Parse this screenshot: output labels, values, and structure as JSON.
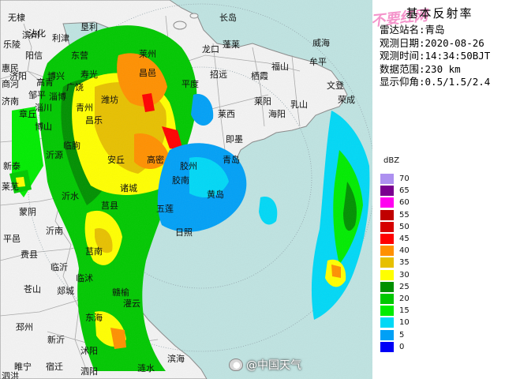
{
  "panel": {
    "title": "基本反射率",
    "stamp": "不要红网",
    "station_label": "雷达站名:青岛",
    "date_label": "观测日期:2020-08-26",
    "time_label": "观测时间:14:34:50BJT",
    "range_label": "数据范围:230 km",
    "elevation_label": "显示仰角:0.5/1.5/2.4"
  },
  "legend": {
    "unit": "dBZ",
    "levels": [
      {
        "label": "70",
        "color": "#ad90f0"
      },
      {
        "label": "65",
        "color": "#7a0090"
      },
      {
        "label": "60",
        "color": "#ff00f0"
      },
      {
        "label": "55",
        "color": "#c00000"
      },
      {
        "label": "50",
        "color": "#d60000"
      },
      {
        "label": "45",
        "color": "#ff0000"
      },
      {
        "label": "40",
        "color": "#ff9000"
      },
      {
        "label": "35",
        "color": "#e7c000"
      },
      {
        "label": "30",
        "color": "#ffff00"
      },
      {
        "label": "25",
        "color": "#009000"
      },
      {
        "label": "20",
        "color": "#00c800"
      },
      {
        "label": "15",
        "color": "#00ec00"
      },
      {
        "label": "10",
        "color": "#00d8f6"
      },
      {
        "label": "5",
        "color": "#01a0f6"
      },
      {
        "label": "0",
        "color": "#0000f6"
      }
    ]
  },
  "cities": [
    "无棣",
    "沾化",
    "利津",
    "寿光",
    "长岛",
    "蓬莱",
    "龙口",
    "招远",
    "栖霞",
    "福山",
    "牟平",
    "威海",
    "文登",
    "荣成",
    "乳山",
    "海阳",
    "莱阳",
    "莱西",
    "平度",
    "即墨",
    "昌邑",
    "潍坊",
    "安丘",
    "高密",
    "胶州",
    "诸城",
    "五莲",
    "日照",
    "莒县",
    "沂水",
    "沂南",
    "蒙阴",
    "费县",
    "临沂",
    "苍山",
    "郯城",
    "莒南",
    "临沭",
    "赣榆",
    "东海",
    "新沂",
    "沭阳",
    "灌云",
    "滨海",
    "邳州",
    "睢宁",
    "宿迁",
    "泗洪",
    "泗阳",
    "涟水",
    "乐陵",
    "阳信",
    "博兴",
    "淄博",
    "沂源",
    "新泰",
    "平邑",
    "莱芜",
    "惠民",
    "济南",
    "邹平",
    "高青",
    "东营",
    "垦利",
    "滨州",
    "商河",
    "济阳",
    "章丘",
    "淄川",
    "博山",
    "临朐",
    "昌乐",
    "青州",
    "广饶",
    "莱州",
    "胶南",
    "黄岛",
    "青岛"
  ],
  "attribution": "@中国天气",
  "colors": {
    "sea": "#bfe3e1",
    "land": "#f3f3f3",
    "boundary": "#9a9a9a"
  }
}
